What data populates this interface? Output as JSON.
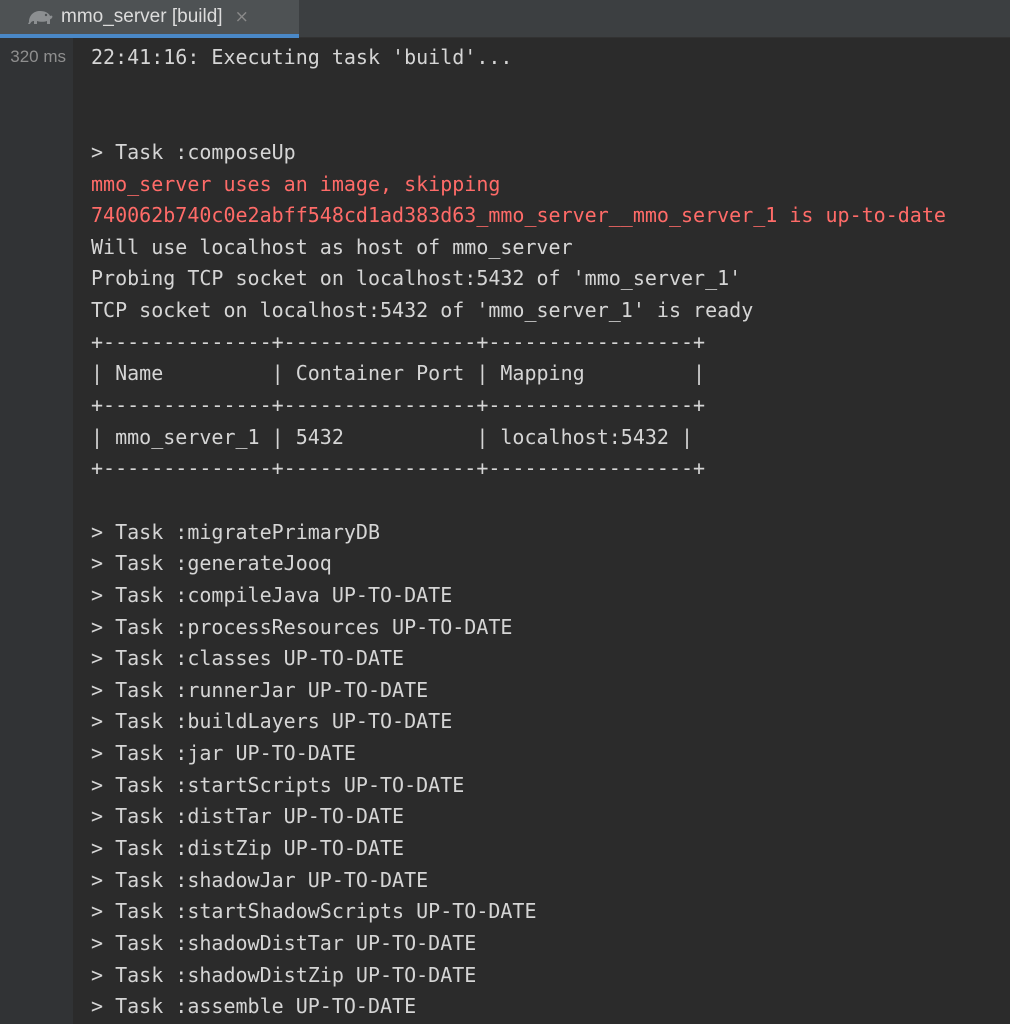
{
  "tab": {
    "icon": "gradle-elephant-icon",
    "title": "mmo_server [build]",
    "close": "×"
  },
  "gutter": {
    "duration": "320 ms"
  },
  "colors": {
    "stdout": "#d5d5d5",
    "stderr": "#ff6b68",
    "accent": "#4a88c7",
    "background": "#2b2b2b"
  },
  "console": {
    "lines": [
      {
        "text": "22:41:16: Executing task 'build'...",
        "type": "out"
      },
      {
        "text": "",
        "type": "out"
      },
      {
        "text": "",
        "type": "out"
      },
      {
        "text": "> Task :composeUp",
        "type": "out"
      },
      {
        "text": "mmo_server uses an image, skipping",
        "type": "err"
      },
      {
        "text": "740062b740c0e2abff548cd1ad383d63_mmo_server__mmo_server_1 is up-to-date",
        "type": "err"
      },
      {
        "text": "Will use localhost as host of mmo_server",
        "type": "out"
      },
      {
        "text": "Probing TCP socket on localhost:5432 of 'mmo_server_1'",
        "type": "out"
      },
      {
        "text": "TCP socket on localhost:5432 of 'mmo_server_1' is ready",
        "type": "out"
      },
      {
        "text": "+--------------+----------------+-----------------+",
        "type": "out"
      },
      {
        "text": "| Name         | Container Port | Mapping         |",
        "type": "out"
      },
      {
        "text": "+--------------+----------------+-----------------+",
        "type": "out"
      },
      {
        "text": "| mmo_server_1 | 5432           | localhost:5432 |",
        "type": "out"
      },
      {
        "text": "+--------------+----------------+-----------------+",
        "type": "out"
      },
      {
        "text": "",
        "type": "out"
      },
      {
        "text": "> Task :migratePrimaryDB",
        "type": "out"
      },
      {
        "text": "> Task :generateJooq",
        "type": "out"
      },
      {
        "text": "> Task :compileJava UP-TO-DATE",
        "type": "out"
      },
      {
        "text": "> Task :processResources UP-TO-DATE",
        "type": "out"
      },
      {
        "text": "> Task :classes UP-TO-DATE",
        "type": "out"
      },
      {
        "text": "> Task :runnerJar UP-TO-DATE",
        "type": "out"
      },
      {
        "text": "> Task :buildLayers UP-TO-DATE",
        "type": "out"
      },
      {
        "text": "> Task :jar UP-TO-DATE",
        "type": "out"
      },
      {
        "text": "> Task :startScripts UP-TO-DATE",
        "type": "out"
      },
      {
        "text": "> Task :distTar UP-TO-DATE",
        "type": "out"
      },
      {
        "text": "> Task :distZip UP-TO-DATE",
        "type": "out"
      },
      {
        "text": "> Task :shadowJar UP-TO-DATE",
        "type": "out"
      },
      {
        "text": "> Task :startShadowScripts UP-TO-DATE",
        "type": "out"
      },
      {
        "text": "> Task :shadowDistTar UP-TO-DATE",
        "type": "out"
      },
      {
        "text": "> Task :shadowDistZip UP-TO-DATE",
        "type": "out"
      },
      {
        "text": "> Task :assemble UP-TO-DATE",
        "type": "out"
      }
    ]
  }
}
